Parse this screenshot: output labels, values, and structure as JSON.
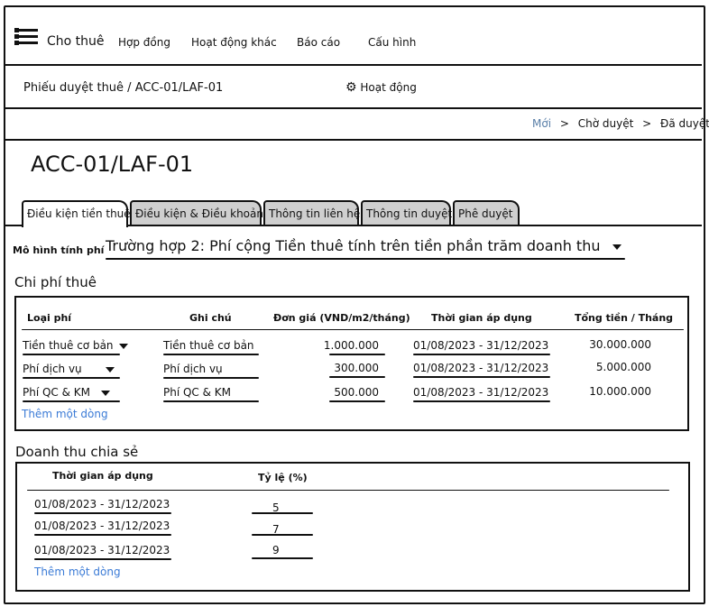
{
  "nav": {
    "brand": "Cho thuê",
    "items": [
      "Hợp đồng",
      "Hoạt động khác",
      "Báo cáo",
      "Cấu hình"
    ]
  },
  "header": {
    "breadcrumb": "Phiếu duyệt thuê / ACC-01/LAF-01",
    "actions_label": "Hoạt động"
  },
  "status_steps": {
    "items": [
      "Mới",
      "Chờ duyệt",
      "Đã duyệt"
    ],
    "separator": ">"
  },
  "title": "ACC-01/LAF-01",
  "tabs": [
    "Điều kiện tiền thuê",
    "Điều kiện & Điều khoản",
    "Thông tin liên hệ",
    "Thông tin duyệt",
    "Phê duyệt"
  ],
  "fee_model": {
    "label": "Mô hình tính phí",
    "value": "Trường hợp 2: Phí cộng Tiền thuê tính trên tiền phần trăm doanh thu"
  },
  "rent_costs": {
    "title": "Chi phí thuê",
    "headers": [
      "Loại phí",
      "Ghi chú",
      "Đơn giá (VND/m2/tháng)",
      "Thời gian áp dụng",
      "Tổng tiền / Tháng"
    ],
    "rows": [
      {
        "type": "Tiền thuê cơ bản",
        "note": "Tiền thuê cơ bản",
        "price": "1.000.000",
        "period_from": "01/08/2023",
        "period_to": "31/12/2023",
        "total": "30.000.000"
      },
      {
        "type": "Phí dịch vụ",
        "note": "Phí dịch vụ",
        "price": "300.000",
        "period_from": "01/08/2023",
        "period_to": "31/12/2023",
        "total": "5.000.000"
      },
      {
        "type": "Phí QC & KM",
        "note": "Phí QC & KM",
        "price": "500.000",
        "period_from": "01/08/2023",
        "period_to": "31/12/2023",
        "total": "10.000.000"
      }
    ],
    "add_row": "Thêm một dòng"
  },
  "revenue_share": {
    "title": "Doanh thu chia sẻ",
    "headers": [
      "Thời gian áp dụng",
      "Tỷ lệ (%)"
    ],
    "rows": [
      {
        "period_from": "01/08/2023",
        "period_to": "31/12/2023",
        "rate": "5"
      },
      {
        "period_from": "01/08/2023",
        "period_to": "31/12/2023",
        "rate": "7"
      },
      {
        "period_from": "01/08/2023",
        "period_to": "31/12/2023",
        "rate": "9"
      }
    ],
    "add_row": "Thêm một dòng"
  },
  "colors": {
    "link": "#3b7bd6",
    "tab_inactive": "#cfcfcf",
    "step_current": "#5a7fa8"
  }
}
